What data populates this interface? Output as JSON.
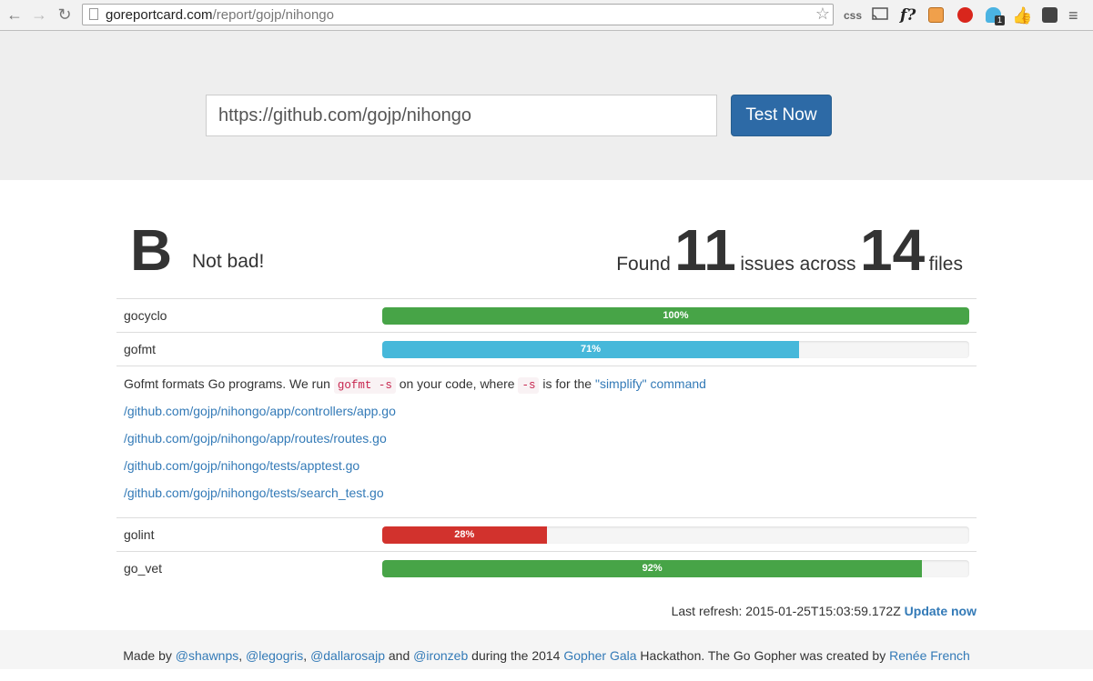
{
  "browser": {
    "url_host": "goreportcard.com",
    "url_path": "/report/gojp/nihongo",
    "ext_css": "css",
    "ext_f": "f?",
    "ext_badge": "1"
  },
  "search": {
    "value": "https://github.com/gojp/nihongo",
    "button": "Test Now"
  },
  "summary": {
    "grade": "B",
    "grade_message": "Not bad!",
    "found_label": "Found",
    "issues": "11",
    "issues_label": "issues across",
    "files": "14",
    "files_label": "files"
  },
  "checks": [
    {
      "name": "gocyclo",
      "percent": 100,
      "label": "100%",
      "color": "#47a447"
    },
    {
      "name": "gofmt",
      "percent": 71,
      "label": "71%",
      "color": "#46b8da"
    },
    {
      "name": "golint",
      "percent": 28,
      "label": "28%",
      "color": "#d2322d"
    },
    {
      "name": "go_vet",
      "percent": 92,
      "label": "92%",
      "color": "#47a447"
    }
  ],
  "gofmt_details": {
    "desc_1": "Gofmt formats Go programs. We run",
    "code_1": "gofmt -s",
    "desc_2": "on your code, where",
    "code_2": "-s",
    "desc_3": "is for the",
    "link": "\"simplify\" command",
    "files": [
      "/github.com/gojp/nihongo/app/controllers/app.go",
      "/github.com/gojp/nihongo/app/routes/routes.go",
      "/github.com/gojp/nihongo/tests/apptest.go",
      "/github.com/gojp/nihongo/tests/search_test.go"
    ]
  },
  "refresh": {
    "label": "Last refresh: 2015-01-25T15:03:59.172Z",
    "action": "Update now"
  },
  "footer": {
    "made_by": "Made by",
    "author_1": "@shawnps",
    "sep_1": ",",
    "author_2": "@legogris",
    "sep_2": ",",
    "author_3": "@dallarosajp",
    "and": "and",
    "author_4": "@ironzeb",
    "during": "during the 2014",
    "event": "Gopher Gala",
    "rest": "Hackathon. The Go Gopher was created by",
    "creator": "Renée French"
  }
}
